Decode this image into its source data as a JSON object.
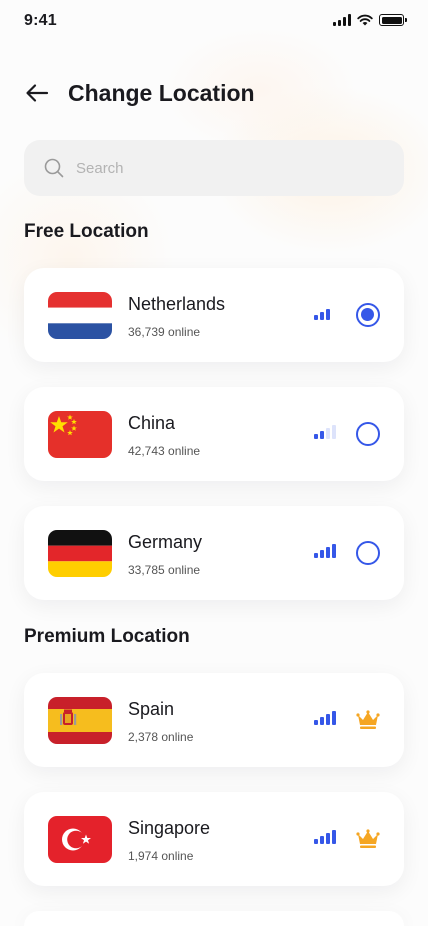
{
  "status_bar": {
    "time": "9:41"
  },
  "header": {
    "title": "Change Location"
  },
  "search": {
    "placeholder": "Search",
    "value": ""
  },
  "sections": {
    "free_title": "Free Location",
    "premium_title": "Premium Location"
  },
  "free_locations": [
    {
      "country": "Netherlands",
      "online": "36,739 online",
      "flag": "netherlands-flag",
      "signal_level": 3,
      "selected": true
    },
    {
      "country": "China",
      "online": "42,743 online",
      "flag": "china-flag",
      "signal_level": 2,
      "selected": false
    },
    {
      "country": "Germany",
      "online": "33,785 online",
      "flag": "germany-flag",
      "signal_level": 4,
      "selected": false
    }
  ],
  "premium_locations": [
    {
      "country": "Spain",
      "online": "2,378 online",
      "flag": "spain-flag",
      "signal_level": 4,
      "premium_icon": "crown-icon"
    },
    {
      "country": "Singapore",
      "online": "1,974 online",
      "flag": "turkey-style-flag",
      "signal_level": 4,
      "premium_icon": "crown-icon"
    }
  ],
  "colors": {
    "accent": "#3557E8",
    "premium": "#F5A623",
    "card": "#FFFFFF",
    "search_bg": "#F1F1F1"
  }
}
